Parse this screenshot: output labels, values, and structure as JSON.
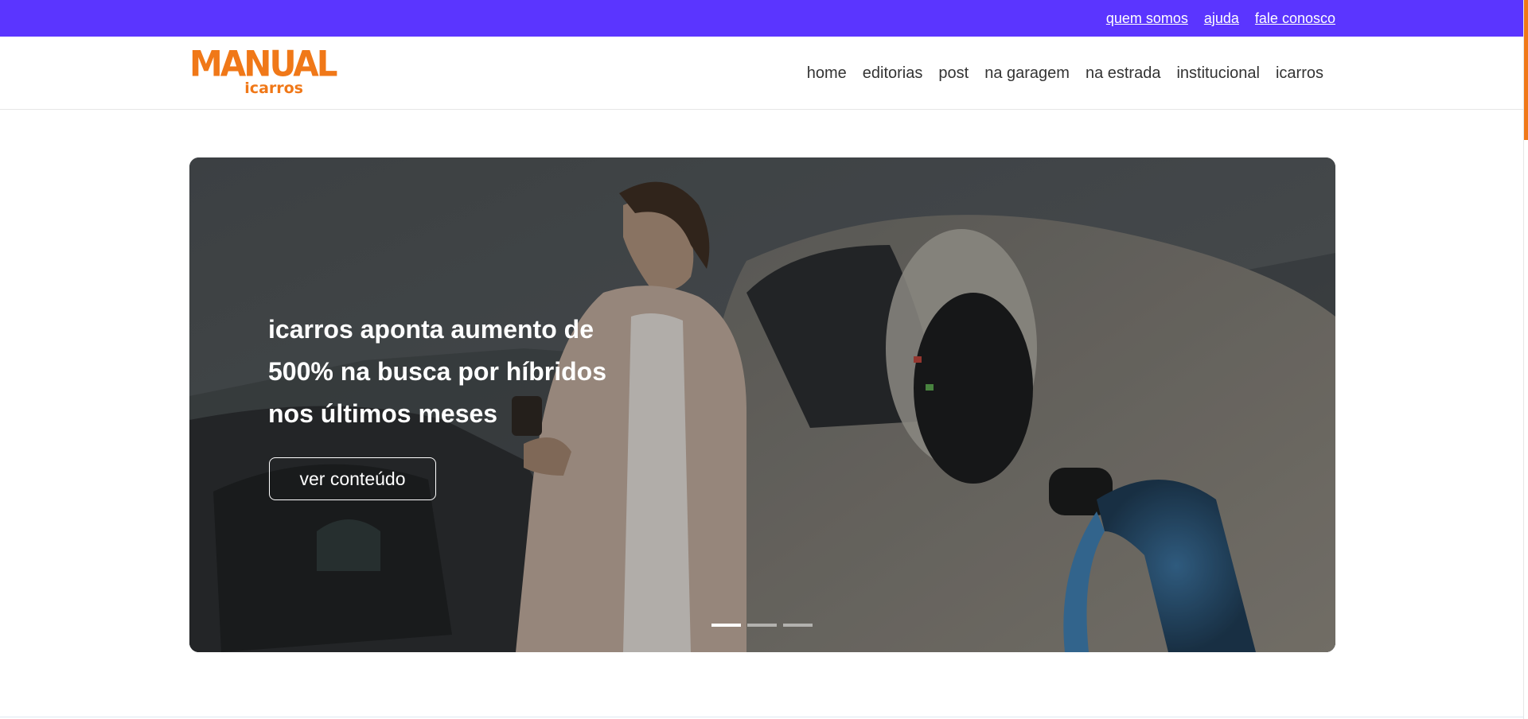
{
  "topbar": {
    "links": [
      "quem somos",
      "ajuda",
      "fale conosco"
    ]
  },
  "logo": {
    "main": "MANUAL",
    "sub": "icarros"
  },
  "nav": {
    "items": [
      "home",
      "editorias",
      "post",
      "na garagem",
      "na estrada",
      "institucional",
      "icarros"
    ]
  },
  "hero": {
    "title": "icarros aponta aumento de 500% na busca por híbridos nos últimos meses",
    "button_label": "ver conteúdo",
    "slides_total": 3,
    "active_slide": 1
  },
  "colors": {
    "topbar": "#5b35ff",
    "brand": "#f07818"
  }
}
